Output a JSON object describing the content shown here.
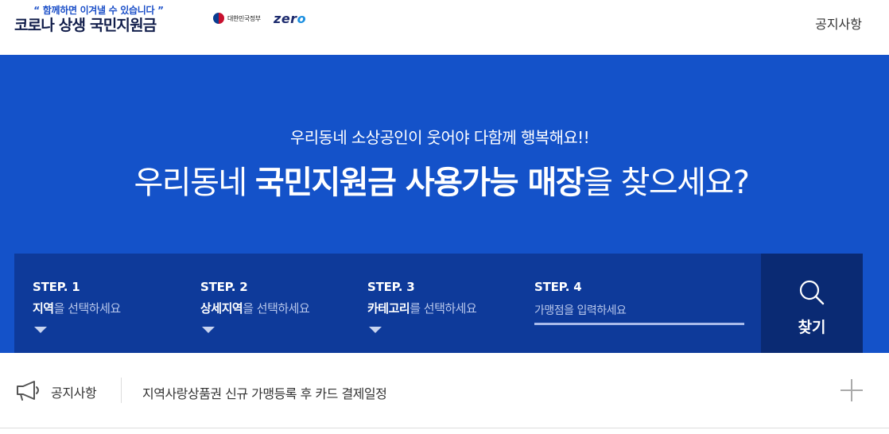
{
  "header": {
    "tagline": "“ 함께하면 이겨낼 수 있습니다 ”",
    "title": "코로나 상생 국민지원금",
    "gov_logo_text": "대한민국정부",
    "zero_logo_prefix": "zer",
    "zero_logo_suffix": "o",
    "notice_link": "공지사항"
  },
  "hero": {
    "subtitle": "우리동네 소상공인이 웃어야 다함께 행복해요!!",
    "title_prefix": "우리동네 ",
    "title_bold": "국민지원금 사용가능 매장",
    "title_suffix": "을 찾으세요?"
  },
  "search": {
    "steps": [
      {
        "label": "STEP. 1",
        "desc_bold": "지역",
        "desc_rest": "을 선택하세요"
      },
      {
        "label": "STEP. 2",
        "desc_bold": "상세지역",
        "desc_rest": "을 선택하세요"
      },
      {
        "label": "STEP. 3",
        "desc_bold": "카테고리",
        "desc_rest": "를 선택하세요"
      },
      {
        "label": "STEP. 4",
        "placeholder": "가맹점을 입력하세요"
      }
    ],
    "find_label": "찾기"
  },
  "notice": {
    "label": "공지사항",
    "text": "지역사랑상품권 신규 가맹등록 후 카드 결제일정"
  },
  "icons": {
    "search": "search-icon",
    "megaphone": "megaphone-icon",
    "plus": "plus-icon",
    "dropdown": "caret-down-icon"
  },
  "colors": {
    "hero_bg": "#1452c9",
    "panel_bg": "#0e3a9a",
    "button_bg": "#0a2a73"
  }
}
